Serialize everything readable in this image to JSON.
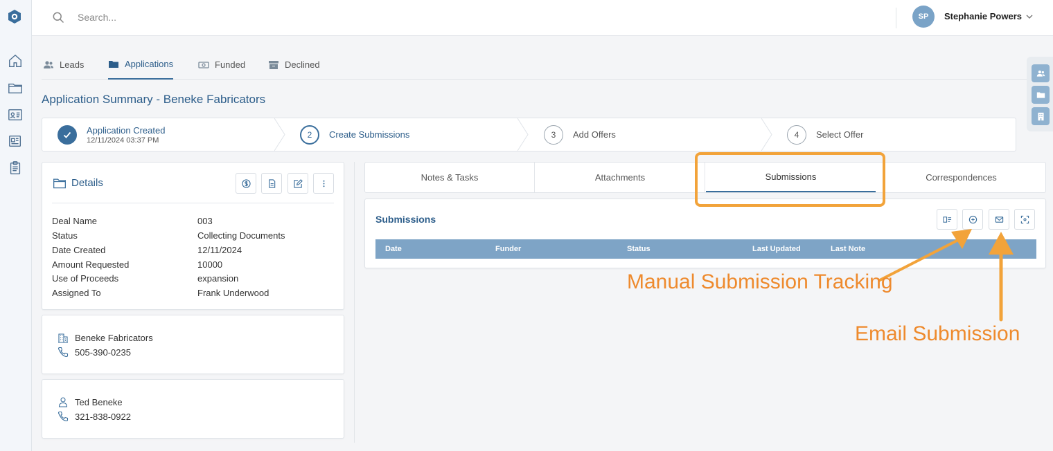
{
  "search": {
    "placeholder": "Search..."
  },
  "user": {
    "initials": "SP",
    "name": "Stephanie Powers"
  },
  "main_tabs": [
    {
      "label": "Leads",
      "icon": "users-icon"
    },
    {
      "label": "Applications",
      "icon": "folder-icon",
      "active": true
    },
    {
      "label": "Funded",
      "icon": "money-icon"
    },
    {
      "label": "Declined",
      "icon": "archive-icon"
    }
  ],
  "page_title": "Application Summary - Beneke Fabricators",
  "steps": [
    {
      "number": "",
      "label": "Application Created",
      "sub": "12/11/2024 03:37 PM",
      "state": "done"
    },
    {
      "number": "2",
      "label": "Create Submissions",
      "state": "current"
    },
    {
      "number": "3",
      "label": "Add Offers",
      "state": "pending"
    },
    {
      "number": "4",
      "label": "Select Offer",
      "state": "pending"
    }
  ],
  "details": {
    "title": "Details",
    "rows": [
      {
        "key": "Deal Name",
        "value": "003"
      },
      {
        "key": "Status",
        "value": "Collecting Documents"
      },
      {
        "key": "Date Created",
        "value": "12/11/2024"
      },
      {
        "key": "Amount Requested",
        "value": "10000"
      },
      {
        "key": "Use of Proceeds",
        "value": "expansion"
      },
      {
        "key": "Assigned To",
        "value": "Frank Underwood"
      }
    ]
  },
  "business": {
    "name": "Beneke Fabricators",
    "phone": "505-390-0235"
  },
  "contact": {
    "name": "Ted Beneke",
    "phone": "321-838-0922"
  },
  "right_tabs": [
    {
      "label": "Notes & Tasks"
    },
    {
      "label": "Attachments"
    },
    {
      "label": "Submissions",
      "active": true
    },
    {
      "label": "Correspondences"
    }
  ],
  "submissions": {
    "title": "Submissions",
    "columns": [
      "Date",
      "Funder",
      "Status",
      "Last Updated",
      "Last Note"
    ]
  },
  "annotations": {
    "manual": "Manual Submission Tracking",
    "email": "Email Submission"
  },
  "colors": {
    "accent": "#3a6e9c",
    "annotation": "#f2a33a",
    "table_header": "#7ea4c6"
  }
}
